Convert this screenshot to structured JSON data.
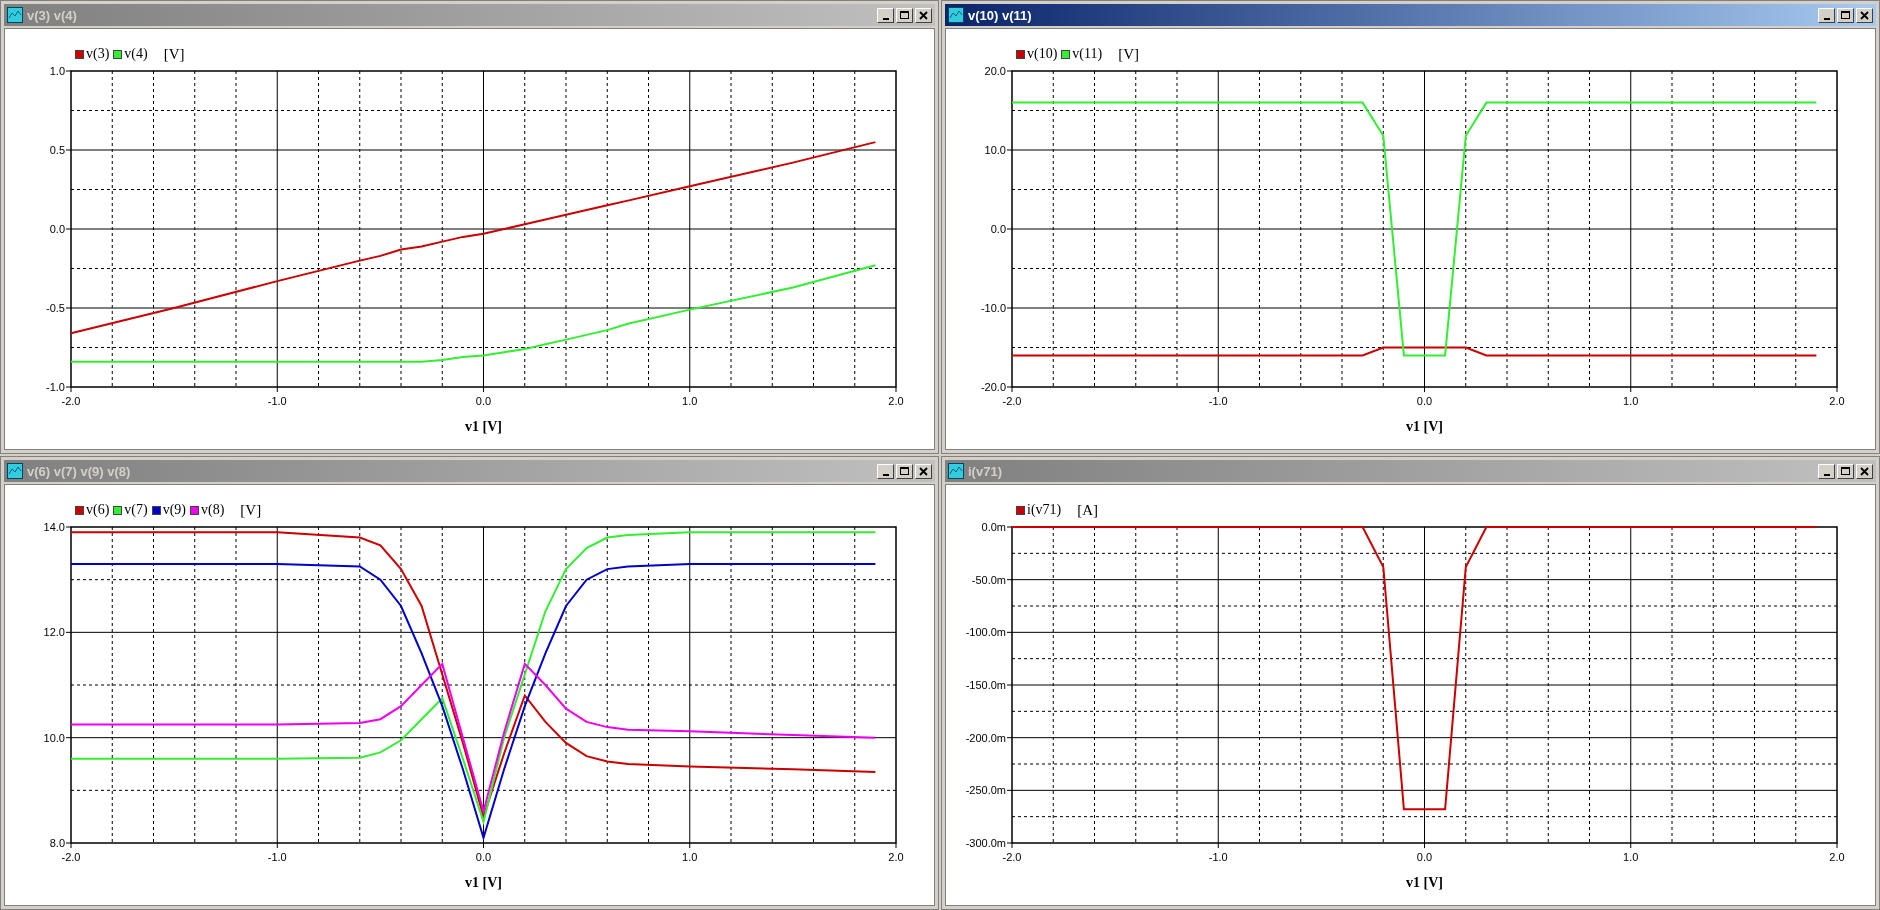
{
  "windows": [
    {
      "title": "v(3) v(4)",
      "active": false,
      "chart_data": {
        "type": "line",
        "xlabel": "v1 [V]",
        "ylabel": "[V]",
        "x": [
          -2,
          -1.5,
          -1,
          -0.6,
          -0.5,
          -0.4,
          -0.3,
          -0.2,
          -0.1,
          0,
          0.1,
          0.2,
          0.3,
          0.4,
          0.5,
          0.6,
          0.7,
          1,
          1.5,
          1.9
        ],
        "xlim": [
          -2,
          2
        ],
        "ylim": [
          -1,
          1
        ],
        "grid": true,
        "xticks": [
          {
            "value": -2,
            "label": "-2.0"
          },
          {
            "value": -1,
            "label": "-1.0"
          },
          {
            "value": 0,
            "label": "0.0"
          },
          {
            "value": 1,
            "label": "1.0"
          },
          {
            "value": 2,
            "label": "2.0"
          }
        ],
        "yticks": [
          {
            "value": -1,
            "label": "-1.0"
          },
          {
            "value": -0.5,
            "label": "-0.5"
          },
          {
            "value": 0,
            "label": "0.0"
          },
          {
            "value": 0.5,
            "label": "0.5"
          },
          {
            "value": 1,
            "label": "1.0"
          }
        ],
        "series": [
          {
            "name": "v(3)",
            "color": "#cc0000",
            "values": [
              -0.66,
              -0.5,
              -0.33,
              -0.2,
              -0.17,
              -0.13,
              -0.11,
              -0.08,
              -0.05,
              -0.03,
              0.0,
              0.03,
              0.06,
              0.09,
              0.12,
              0.15,
              0.18,
              0.27,
              0.42,
              0.55
            ]
          },
          {
            "name": "v(4)",
            "color": "#33ee33",
            "values": [
              -0.84,
              -0.84,
              -0.84,
              -0.84,
              -0.84,
              -0.84,
              -0.84,
              -0.83,
              -0.81,
              -0.8,
              -0.78,
              -0.76,
              -0.73,
              -0.7,
              -0.67,
              -0.64,
              -0.6,
              -0.51,
              -0.37,
              -0.23
            ]
          }
        ]
      }
    },
    {
      "title": "v(10) v(11)",
      "active": true,
      "chart_data": {
        "type": "line",
        "xlabel": "v1 [V]",
        "ylabel": "[V]",
        "x": [
          -2,
          -1.5,
          -1,
          -0.6,
          -0.5,
          -0.4,
          -0.3,
          -0.2,
          -0.1,
          0,
          0.1,
          0.2,
          0.3,
          0.4,
          0.5,
          0.6,
          0.7,
          1,
          1.5,
          1.9
        ],
        "xlim": [
          -2,
          2
        ],
        "ylim": [
          -20,
          20
        ],
        "grid": true,
        "xticks": [
          {
            "value": -2,
            "label": "-2.0"
          },
          {
            "value": -1,
            "label": "-1.0"
          },
          {
            "value": 0,
            "label": "0.0"
          },
          {
            "value": 1,
            "label": "1.0"
          },
          {
            "value": 2,
            "label": "2.0"
          }
        ],
        "yticks": [
          {
            "value": -20,
            "label": "-20.0"
          },
          {
            "value": -10,
            "label": "-10.0"
          },
          {
            "value": 0,
            "label": "0.0"
          },
          {
            "value": 10,
            "label": "10.0"
          },
          {
            "value": 20,
            "label": "20.0"
          }
        ],
        "series": [
          {
            "name": "v(10)",
            "color": "#cc0000",
            "values": [
              -16,
              -16,
              -16,
              -16,
              -16,
              -16,
              -16,
              -15,
              -15,
              -15,
              -15,
              -15,
              -16,
              -16,
              -16,
              -16,
              -16,
              -16,
              -16,
              -16
            ]
          },
          {
            "name": "v(11)",
            "color": "#33ee33",
            "values": [
              16,
              16,
              16,
              16,
              16,
              16,
              16,
              11.8,
              -16,
              -16,
              -16,
              11.8,
              16,
              16,
              16,
              16,
              16,
              16,
              16,
              16
            ]
          }
        ]
      }
    },
    {
      "title": "v(6) v(7) v(9) v(8)",
      "active": false,
      "chart_data": {
        "type": "line",
        "xlabel": "v1 [V]",
        "ylabel": "[V]",
        "x": [
          -2,
          -1.5,
          -1,
          -0.6,
          -0.5,
          -0.4,
          -0.3,
          -0.2,
          -0.1,
          0,
          0.1,
          0.2,
          0.3,
          0.4,
          0.5,
          0.6,
          0.7,
          1,
          1.5,
          1.9
        ],
        "xlim": [
          -2,
          2
        ],
        "ylim": [
          8,
          14
        ],
        "grid": true,
        "xticks": [
          {
            "value": -2,
            "label": "-2.0"
          },
          {
            "value": -1,
            "label": "-1.0"
          },
          {
            "value": 0,
            "label": "0.0"
          },
          {
            "value": 1,
            "label": "1.0"
          },
          {
            "value": 2,
            "label": "2.0"
          }
        ],
        "yticks": [
          {
            "value": 8,
            "label": "8.0"
          },
          {
            "value": 10,
            "label": "10.0"
          },
          {
            "value": 12,
            "label": "12.0"
          },
          {
            "value": 14,
            "label": "14.0"
          }
        ],
        "series": [
          {
            "name": "v(6)",
            "color": "#cc0000",
            "values": [
              13.9,
              13.9,
              13.9,
              13.8,
              13.65,
              13.2,
              12.5,
              11.2,
              9.9,
              8.5,
              9.7,
              10.8,
              10.3,
              9.9,
              9.65,
              9.55,
              9.5,
              9.45,
              9.4,
              9.35
            ]
          },
          {
            "name": "v(7)",
            "color": "#33ee33",
            "values": [
              9.6,
              9.6,
              9.6,
              9.62,
              9.72,
              9.95,
              10.35,
              10.75,
              9.6,
              8.4,
              10.0,
              11.2,
              12.4,
              13.2,
              13.6,
              13.8,
              13.85,
              13.9,
              13.9,
              13.9
            ]
          },
          {
            "name": "v(9)",
            "color": "#0000cc",
            "values": [
              13.3,
              13.3,
              13.3,
              13.25,
              13.0,
              12.5,
              11.6,
              10.6,
              9.4,
              8.1,
              9.4,
              10.6,
              11.6,
              12.5,
              13.0,
              13.2,
              13.25,
              13.3,
              13.3,
              13.3
            ]
          },
          {
            "name": "v(8)",
            "color": "#ee00ee",
            "values": [
              10.25,
              10.25,
              10.25,
              10.28,
              10.35,
              10.6,
              11.0,
              11.4,
              10.0,
              8.6,
              10.1,
              11.4,
              11.0,
              10.55,
              10.3,
              10.2,
              10.15,
              10.12,
              10.05,
              10.0
            ]
          }
        ]
      }
    },
    {
      "title": "i(v71)",
      "active": false,
      "chart_data": {
        "type": "line",
        "xlabel": "v1 [V]",
        "ylabel": "[A]",
        "x": [
          -2,
          -1.5,
          -1,
          -0.6,
          -0.5,
          -0.4,
          -0.3,
          -0.2,
          -0.1,
          0,
          0.1,
          0.2,
          0.3,
          0.4,
          0.5,
          0.6,
          0.7,
          1,
          1.5,
          1.9
        ],
        "xlim": [
          -2,
          2
        ],
        "ylim": [
          -300,
          0
        ],
        "grid": true,
        "xticks": [
          {
            "value": -2,
            "label": "-2.0"
          },
          {
            "value": -1,
            "label": "-1.0"
          },
          {
            "value": 0,
            "label": "0.0"
          },
          {
            "value": 1,
            "label": "1.0"
          },
          {
            "value": 2,
            "label": "2.0"
          }
        ],
        "yticks": [
          {
            "value": -300,
            "label": "-300.0m"
          },
          {
            "value": -250,
            "label": "-250.0m"
          },
          {
            "value": -200,
            "label": "-200.0m"
          },
          {
            "value": -150,
            "label": "-150.0m"
          },
          {
            "value": -100,
            "label": "-100.0m"
          },
          {
            "value": -50,
            "label": "-50.0m"
          },
          {
            "value": 0,
            "label": "0.0m"
          }
        ],
        "series": [
          {
            "name": "i(v71)",
            "color": "#cc0000",
            "values": [
              0,
              0,
              0,
              0,
              0,
              0,
              0,
              -38,
              -268,
              -268,
              -268,
              -38,
              0,
              0,
              0,
              0,
              0,
              0,
              0,
              0
            ]
          }
        ]
      }
    }
  ]
}
